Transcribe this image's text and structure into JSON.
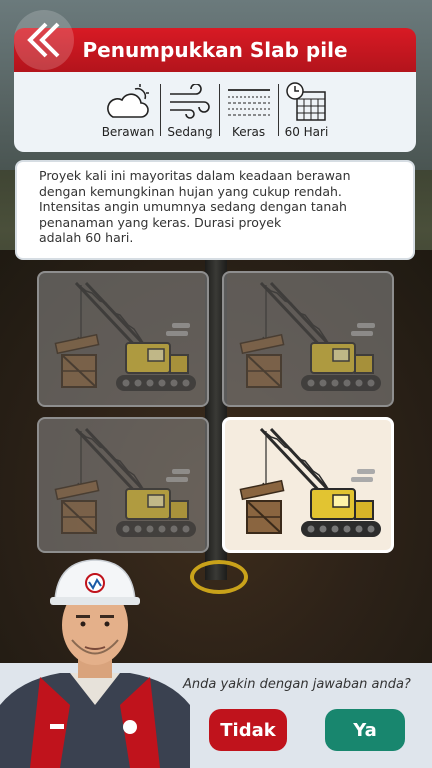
{
  "header": {
    "title": "Penumpukkan Slab pile"
  },
  "conditions": [
    {
      "icon": "cloud-icon",
      "label": "Berawan"
    },
    {
      "icon": "wind-icon",
      "label": "Sedang"
    },
    {
      "icon": "soil-icon",
      "label": "Keras"
    },
    {
      "icon": "calendar-icon",
      "label": "60 Hari"
    }
  ],
  "description": {
    "lines": [
      "Proyek kali ini mayoritas dalam keadaan berawan",
      "dengan kemungkinan hujan yang cukup rendah.",
      "Intensitas angin umumnya sedang dengan tanah",
      "penanaman yang keras. Durasi proyek",
      "adalah 60 hari."
    ]
  },
  "options": [
    {
      "name": "crane-option-1",
      "selected": false
    },
    {
      "name": "crane-option-2",
      "selected": false
    },
    {
      "name": "crane-option-3",
      "selected": false
    },
    {
      "name": "crane-option-4",
      "selected": true
    }
  ],
  "confirm": {
    "question": "Anda yakin dengan jawaban anda?",
    "no_label": "Tidak",
    "yes_label": "Ya"
  },
  "colors": {
    "header": "#d81a24",
    "no": "#c0131c",
    "yes": "#18866e"
  }
}
